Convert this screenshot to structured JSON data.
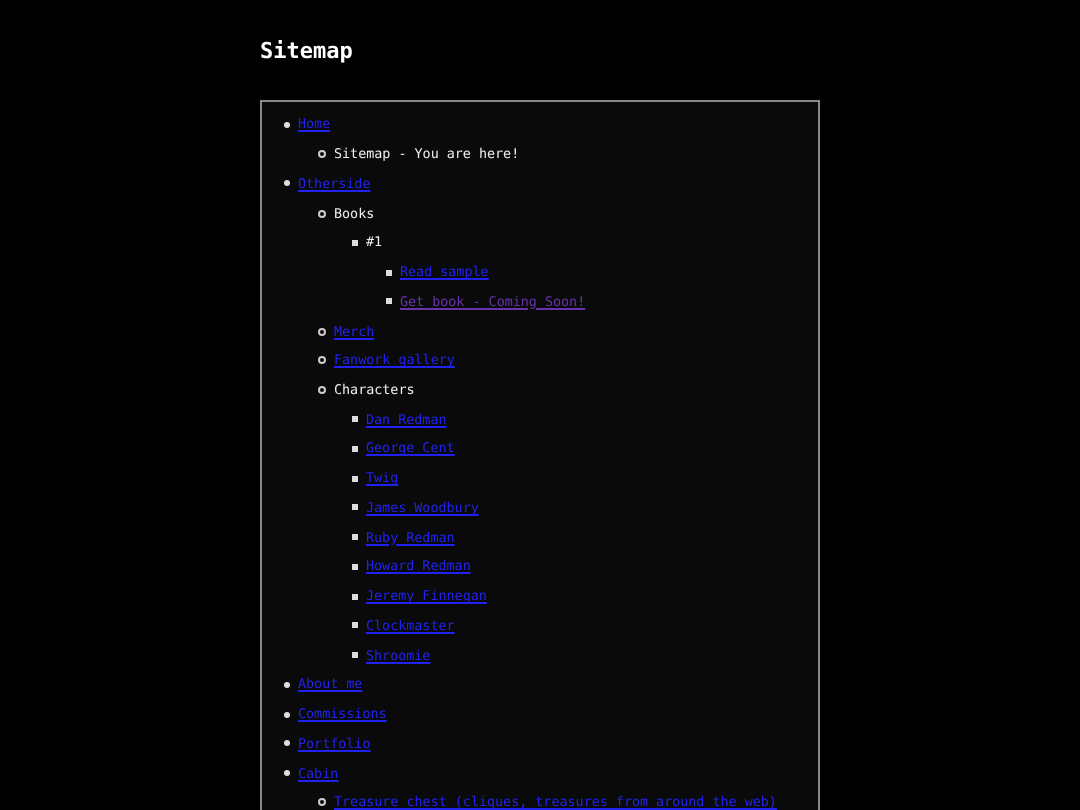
{
  "page_title": "Sitemap",
  "sitemap": [
    {
      "label": "Home",
      "kind": "link",
      "visited": false,
      "children": [
        {
          "label": "Sitemap - You are here!",
          "kind": "text"
        }
      ]
    },
    {
      "label": "Otherside",
      "kind": "link",
      "visited": false,
      "children": [
        {
          "label": "Books",
          "kind": "text",
          "children": [
            {
              "label": "#1",
              "kind": "text",
              "children": [
                {
                  "label": "Read sample",
                  "kind": "link",
                  "visited": false
                },
                {
                  "label": "Get book - Coming Soon!",
                  "kind": "link",
                  "visited": true
                }
              ]
            }
          ]
        },
        {
          "label": "Merch",
          "kind": "link",
          "visited": false
        },
        {
          "label": "Fanwork gallery",
          "kind": "link",
          "visited": false
        },
        {
          "label": "Characters",
          "kind": "text",
          "children": [
            {
              "label": "Dan Redman",
              "kind": "link",
              "visited": false
            },
            {
              "label": "George Cent",
              "kind": "link",
              "visited": false
            },
            {
              "label": "Twig",
              "kind": "link",
              "visited": false
            },
            {
              "label": "James Woodbury",
              "kind": "link",
              "visited": false
            },
            {
              "label": "Ruby Redman",
              "kind": "link",
              "visited": false
            },
            {
              "label": "Howard Redman",
              "kind": "link",
              "visited": false
            },
            {
              "label": "Jeremy Finnegan",
              "kind": "link",
              "visited": false
            },
            {
              "label": "Clockmaster",
              "kind": "link",
              "visited": false
            },
            {
              "label": "Shroomie",
              "kind": "link",
              "visited": false
            }
          ]
        }
      ]
    },
    {
      "label": "About me",
      "kind": "link",
      "visited": false
    },
    {
      "label": "Commissions",
      "kind": "link",
      "visited": false
    },
    {
      "label": "Portfolio",
      "kind": "link",
      "visited": false
    },
    {
      "label": "Cabin",
      "kind": "link",
      "visited": false,
      "children": [
        {
          "label": "Treasure chest (cliques, treasures from around the web)",
          "kind": "link",
          "visited": false
        }
      ]
    }
  ]
}
